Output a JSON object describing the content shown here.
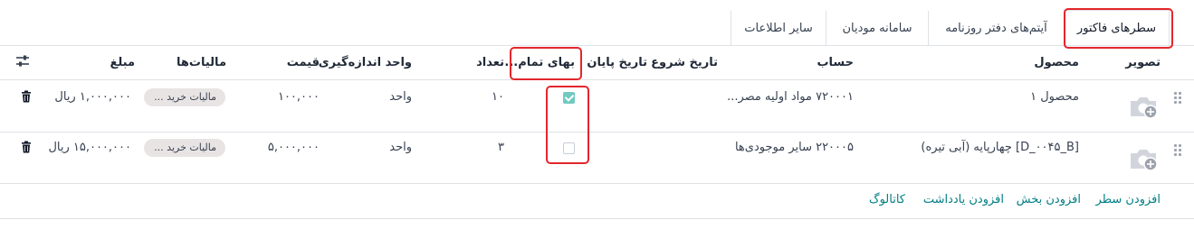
{
  "tabs": [
    {
      "label": "سطرهای فاکتور",
      "active": true
    },
    {
      "label": "آیتم‌های دفتر روزنامه",
      "active": false
    },
    {
      "label": "سامانه مودیان",
      "active": false
    },
    {
      "label": "سایر اطلاعات",
      "active": false
    }
  ],
  "columns": {
    "image": "تصویر",
    "product": "محصول",
    "account": "حساب",
    "start_date": "تاریخ شروع",
    "end_date": "تاریخ پایان",
    "deferred": "بهای تمام...",
    "quantity": "تعداد",
    "uom": "واحد اندازه‌گیری",
    "price": "قیمت",
    "taxes": "مالیات‌ها",
    "amount": "مبلغ"
  },
  "rows": [
    {
      "product": "محصول ۱",
      "account": "۷۲۰۰۰۱ مواد اولیه مصر...",
      "deferred_checked": true,
      "quantity": "۱۰",
      "uom": "واحد",
      "price": "۱۰۰,۰۰۰",
      "tax": "مالیات خرید ...",
      "amount": "۱,۰۰۰,۰۰۰ ریال"
    },
    {
      "product": "[D_۰۰۴۵_B] چهارپایه (آبی تیره)",
      "account": "۲۲۰۰۰۵ سایر موجودی‌ها",
      "deferred_checked": false,
      "quantity": "۳",
      "uom": "واحد",
      "price": "۵,۰۰۰,۰۰۰",
      "tax": "مالیات خرید ...",
      "amount": "۱۵,۰۰۰,۰۰۰ ریال"
    }
  ],
  "actions": {
    "add_line": "افزودن سطر",
    "add_section": "افزودن بخش",
    "add_note": "افزودن یادداشت",
    "catalog": "کاتالوگ"
  },
  "colors": {
    "accent": "#017e84",
    "highlight": "#e3262c",
    "checkbox": "#71c9c0"
  }
}
